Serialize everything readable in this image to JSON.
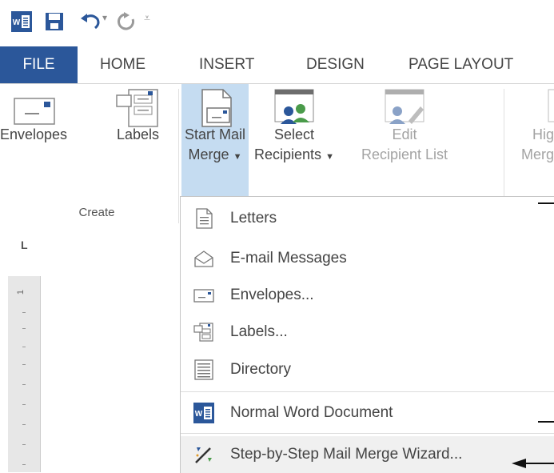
{
  "tabs": {
    "file": "FILE",
    "home": "HOME",
    "insert": "INSERT",
    "design": "DESIGN",
    "page_layout": "PAGE LAYOUT"
  },
  "ribbon": {
    "envelopes": "Envelopes",
    "labels": "Labels",
    "start_mail_merge_line1": "Start Mail",
    "start_mail_merge_line2": "Merge",
    "select_recipients_line1": "Select",
    "select_recipients_line2": "Recipients",
    "edit_recipient_line1": "Edit",
    "edit_recipient_line2": "Recipient List",
    "highlight_line1": "Hig",
    "highlight_line2": "Merg",
    "group_create": "Create"
  },
  "ruler": {
    "corner_mark": "L",
    "number": "1"
  },
  "menu": {
    "items": [
      {
        "label": "Letters"
      },
      {
        "label": "E-mail Messages"
      },
      {
        "label": "Envelopes..."
      },
      {
        "label": "Labels..."
      },
      {
        "label": "Directory"
      },
      {
        "label": "Normal Word Document"
      },
      {
        "label": "Step-by-Step Mail Merge Wizard..."
      }
    ]
  },
  "colors": {
    "accent": "#2b579a",
    "selected": "#c5dcf1",
    "disabled": "#a3a3a3"
  }
}
